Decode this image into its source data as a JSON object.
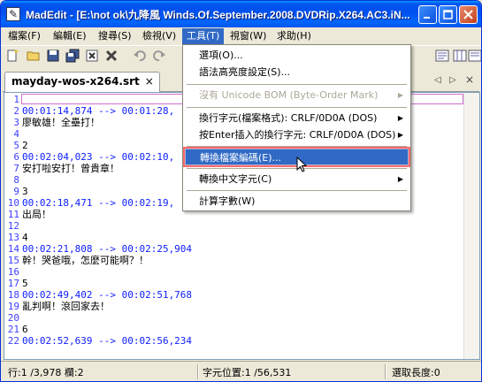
{
  "window": {
    "title": "MadEdit - [E:\\not ok\\九降風 Winds.Of.September.2008.DVDRip.X264.AC3.iN..."
  },
  "menubar": {
    "items": [
      "檔案(F)",
      "編輯(E)",
      "搜尋(S)",
      "檢視(V)",
      "工具(T)",
      "視窗(W)",
      "求助(H)"
    ],
    "active_index": 4
  },
  "tabs": {
    "file_tab": "mayday-wos-x264.srt",
    "close_glyph": "×",
    "nav_left": "◁",
    "nav_right": "▷",
    "nav_close": "×"
  },
  "editor": {
    "lines": [
      {
        "n": "1",
        "text": "",
        "ts": false
      },
      {
        "n": "2",
        "text": "00:01:14,874 --> 00:01:28,",
        "ts": true
      },
      {
        "n": "3",
        "text": "廖敏雄！全壘打！",
        "ts": false
      },
      {
        "n": "4",
        "text": "",
        "ts": false
      },
      {
        "n": "5",
        "text": "2",
        "ts": false
      },
      {
        "n": "6",
        "text": "00:02:04,023 --> 00:02:10,",
        "ts": true
      },
      {
        "n": "7",
        "text": "安打啦安打！曾貴章！",
        "ts": false
      },
      {
        "n": "8",
        "text": "",
        "ts": false
      },
      {
        "n": "9",
        "text": "3",
        "ts": false
      },
      {
        "n": "10",
        "text": "00:02:18,471 --> 00:02:19,",
        "ts": true
      },
      {
        "n": "11",
        "text": "出局！",
        "ts": false
      },
      {
        "n": "12",
        "text": "",
        "ts": false
      },
      {
        "n": "13",
        "text": "4",
        "ts": false
      },
      {
        "n": "14",
        "text": "00:02:21,808 --> 00:02:25,904",
        "ts": true
      },
      {
        "n": "15",
        "text": "幹！哭爸哦，怎麼可能啊？！",
        "ts": false
      },
      {
        "n": "16",
        "text": "",
        "ts": false
      },
      {
        "n": "17",
        "text": "5",
        "ts": false
      },
      {
        "n": "18",
        "text": "00:02:49,402 --> 00:02:51,768",
        "ts": true
      },
      {
        "n": "19",
        "text": "亂判啊！滾回家去！",
        "ts": false
      },
      {
        "n": "20",
        "text": "",
        "ts": false
      },
      {
        "n": "21",
        "text": "6",
        "ts": false
      },
      {
        "n": "22",
        "text": "00:02:52,639 --> 00:02:56,234",
        "ts": true
      }
    ]
  },
  "tools_menu": {
    "items": [
      {
        "label": "選項(O)...",
        "disabled": false,
        "submenu": false
      },
      {
        "label": "語法高亮度設定(S)...",
        "disabled": false,
        "submenu": false
      },
      {
        "label": "沒有 Unicode BOM (Byte-Order Mark)",
        "disabled": true,
        "submenu": true
      },
      {
        "label": "換行字元(檔案格式): CRLF/0D0A (DOS)",
        "disabled": false,
        "submenu": true
      },
      {
        "label": "按Enter插入的換行字元: CRLF/0D0A (DOS)",
        "disabled": false,
        "submenu": true
      },
      {
        "label": "轉換檔案編碼(E)...",
        "disabled": false,
        "submenu": false,
        "highlighted": true
      },
      {
        "label": "轉換中文字元(C)",
        "disabled": false,
        "submenu": true
      },
      {
        "label": "計算字數(W)",
        "disabled": false,
        "submenu": false
      }
    ],
    "arrow_glyph": "▶"
  },
  "statusbar": {
    "position": "行:1 /3,978 欄:2",
    "char_pos": "字元位置:1 /56,531",
    "selection": "選取長度:0"
  },
  "colors": {
    "titlebar": "#0053ee",
    "menu_highlight": "#316ac5",
    "line_numbers": "#4040ff",
    "timestamps": "#1020ff"
  }
}
